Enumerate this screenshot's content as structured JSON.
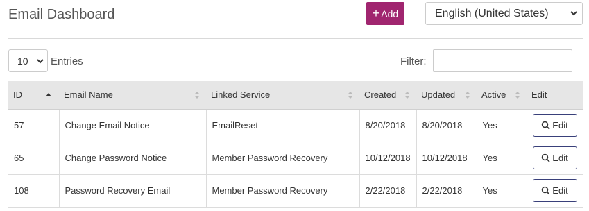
{
  "header": {
    "title": "Email Dashboard",
    "add_label": "Add",
    "language": "English (United States)"
  },
  "controls": {
    "entries_value": "10",
    "entries_label": "Entries",
    "filter_label": "Filter:",
    "filter_value": ""
  },
  "table": {
    "columns": [
      "ID",
      "Email Name",
      "Linked Service",
      "Created",
      "Updated",
      "Active",
      "Edit"
    ],
    "edit_label": "Edit",
    "rows": [
      {
        "id": "57",
        "name": "Change Email Notice",
        "service": "EmailReset",
        "created": "8/20/2018",
        "updated": "8/20/2018",
        "active": "Yes"
      },
      {
        "id": "65",
        "name": "Change Password Notice",
        "service": "Member Password Recovery",
        "created": "10/12/2018",
        "updated": "10/12/2018",
        "active": "Yes"
      },
      {
        "id": "108",
        "name": "Password Recovery Email",
        "service": "Member Password Recovery",
        "created": "2/22/2018",
        "updated": "2/22/2018",
        "active": "Yes"
      }
    ]
  },
  "colors": {
    "accent": "#a0256f",
    "header_bg": "#e6e6e6",
    "edit_border": "#39407a"
  }
}
